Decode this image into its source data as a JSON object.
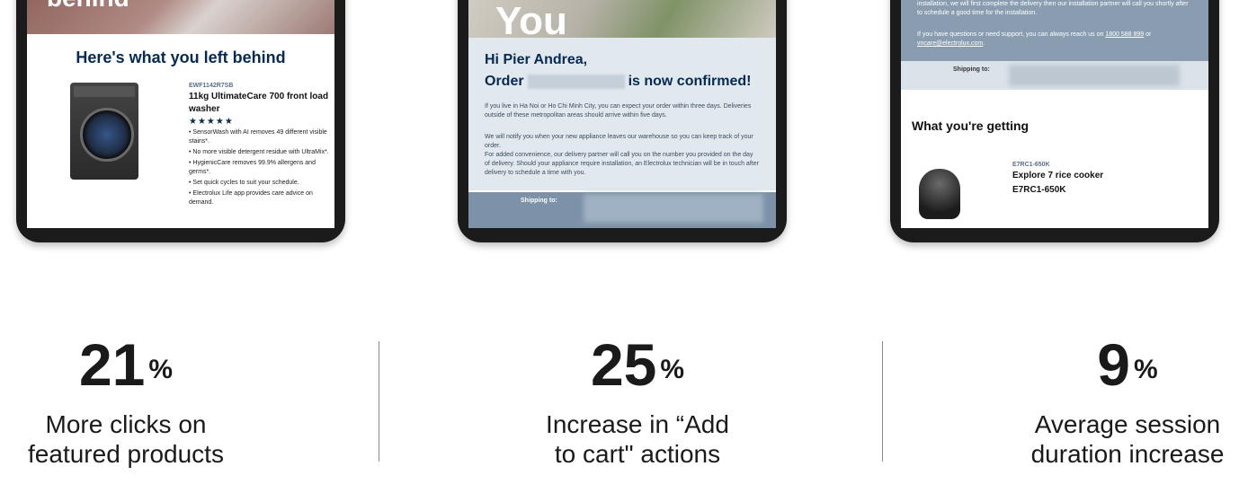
{
  "tablet1": {
    "hero_word": "behind",
    "title": "Here's what you left behind",
    "product": {
      "code": "EWF1142R7SB",
      "name": "11kg UltimateCare 700 front load washer",
      "stars": "★★★★★",
      "bullets": [
        "• SensorWash with AI removes 49 different visible stains*.",
        "• No more visible detergent residue with UltraMix*.",
        "• HygienicCare removes 99.9% allergens and germs*.",
        "• Set quick cycles to suit your schedule.",
        "• Electrolux Life app provides care advice on demand."
      ]
    }
  },
  "tablet2": {
    "hero_word": "You",
    "greeting": "Hi Pier Andrea,",
    "order_prefix": "Order",
    "order_suffix": "is now confirmed!",
    "para1": "If you live in Ha Noi or Ho Chi Minh City, you can expect your order within three days. Deliveries outside of these metropolitan areas should arrive within five days.",
    "para2": "We will notify you when your new appliance leaves our warehouse so you can keep track of your order.",
    "para3": "For added convenience, our delivery partner will call you on the number you provided on the day of delivery. Should your appliance require installation, an Electrolux technician will be in touch after delivery to schedule a time with you.",
    "shipping_label": "Shipping to:"
  },
  "tablet3": {
    "para1": "installation, we will first complete the delivery then our installation partner will call you shortly after to schedule a good time for the installation.",
    "para2_prefix": "If you have questions or need support, you can always reach us on ",
    "phone": "1800 588 899",
    "para2_mid": " or ",
    "email": "vncare@electrolux.com",
    "para2_suffix": ".",
    "shipping_label": "Shipping to:",
    "section_title": "What you're getting",
    "product": {
      "code": "E7RC1-650K",
      "name": "Explore 7 rice cooker",
      "model": "E7RC1-650K"
    }
  },
  "stats": [
    {
      "value": "21",
      "unit": "%",
      "line1": "More clicks on",
      "line2": "featured products"
    },
    {
      "value": "25",
      "unit": "%",
      "line1": "Increase in “Add",
      "line2": "to cart\" actions"
    },
    {
      "value": "9",
      "unit": "%",
      "line1": "Average session",
      "line2": "duration increase"
    }
  ]
}
